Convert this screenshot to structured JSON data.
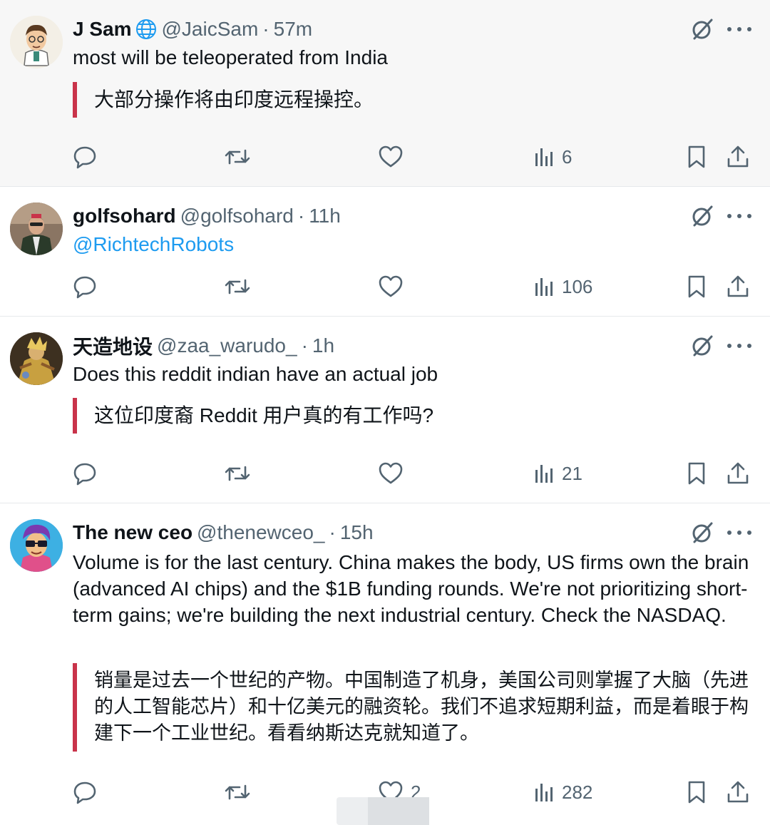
{
  "tweets": [
    {
      "name": "J Sam",
      "handle": "@JaicSam",
      "separator": "·",
      "time": "57m",
      "text": "most will be teleoperated from India",
      "translation": "大部分操作将由印度远程操控。",
      "views": "6",
      "likes": ""
    },
    {
      "name": "golfsohard",
      "handle": "@golfsohard",
      "separator": "·",
      "time": "11h",
      "mention": "@RichtechRobots",
      "views": "106",
      "likes": ""
    },
    {
      "name": "天造地设",
      "handle": "@zaa_warudo_",
      "separator": "·",
      "time": "1h",
      "text": "Does this reddit indian have an actual job",
      "translation": "这位印度裔 Reddit 用户真的有工作吗?",
      "views": "21",
      "likes": ""
    },
    {
      "name": "The new ceo",
      "handle": "@thenewceo_",
      "separator": "·",
      "time": "15h",
      "text": "Volume is for the last century. China makes the body, US firms own the brain (advanced AI chips) and the $1B funding rounds. We're not prioritizing short-term gains; we're building the next industrial century. Check the NASDAQ.",
      "translation": "销量是过去一个世纪的产物。中国制造了机身，美国公司则掌握了大脑（先进的人工智能芯片）和十亿美元的融资轮。我们不追求短期利益，而是着眼于构建下一个工业世纪。看看纳斯达克就知道了。",
      "views": "282",
      "likes": "2"
    }
  ],
  "icons": {
    "reply": "reply-icon",
    "retweet": "retweet-icon",
    "like": "heart-icon",
    "views": "views-icon",
    "bookmark": "bookmark-icon",
    "share": "share-icon",
    "grok": "grok-icon",
    "more": "more-icon",
    "verified": "globe-icon"
  },
  "colors": {
    "text": "#0f1419",
    "secondary": "#536471",
    "link": "#1d9bf0",
    "quote_bar": "#c9334a"
  }
}
